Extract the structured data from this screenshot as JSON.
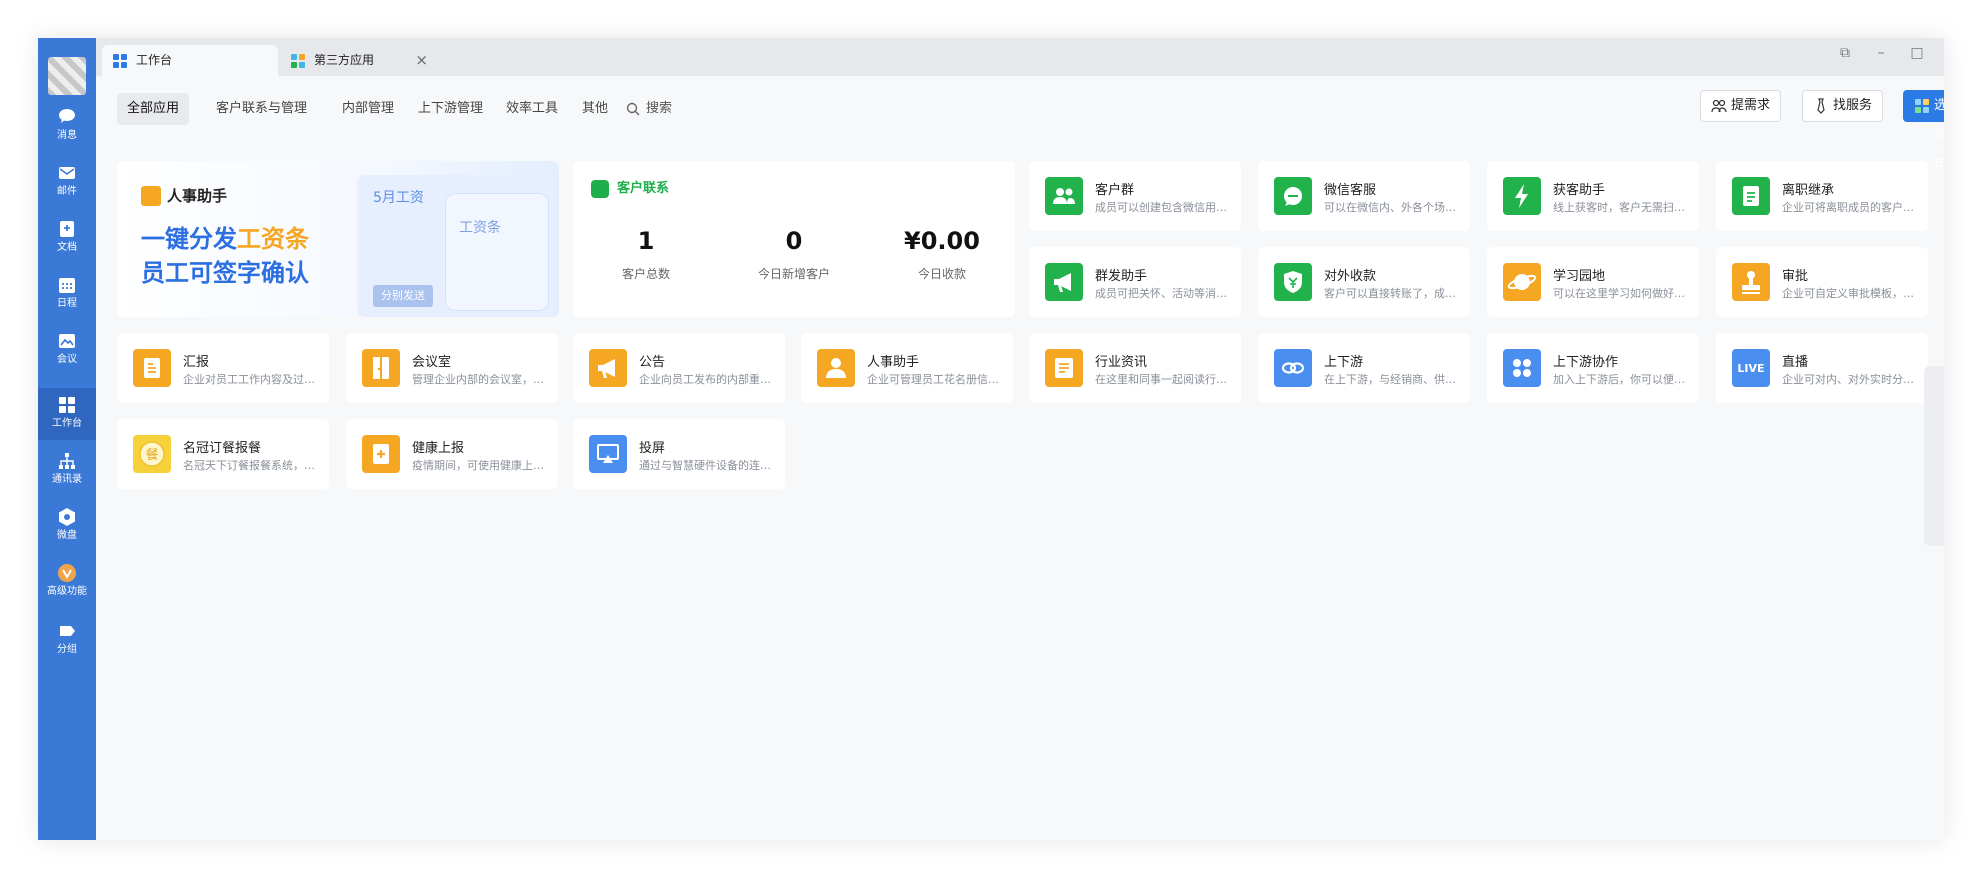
{
  "sidebar": {
    "items": [
      {
        "label": "消息",
        "icon": "chat-bubble-icon"
      },
      {
        "label": "邮件",
        "icon": "mail-icon"
      },
      {
        "label": "文档",
        "icon": "document-icon"
      },
      {
        "label": "日程",
        "icon": "calendar-icon"
      },
      {
        "label": "会议",
        "icon": "meeting-icon"
      },
      {
        "label": "工作台",
        "icon": "workbench-icon"
      },
      {
        "label": "通讯录",
        "icon": "contacts-icon"
      },
      {
        "label": "微盘",
        "icon": "drive-icon"
      },
      {
        "label": "高级功能",
        "icon": "advanced-icon"
      },
      {
        "label": "分组",
        "icon": "group-icon"
      }
    ]
  },
  "tabs": [
    {
      "label": "工作台"
    },
    {
      "label": "第三方应用"
    }
  ],
  "filters": [
    "全部应用",
    "客户联系与管理",
    "内部管理",
    "上下游管理",
    "效率工具",
    "其他"
  ],
  "search": {
    "label": "搜索"
  },
  "actions": {
    "request": "提需求",
    "service": "找服务",
    "select_apps": "选应用"
  },
  "banner": {
    "title": "人事助手",
    "line1_pre": "一键分发",
    "line1_accent": "工资条",
    "line2": "员工可签字确认",
    "card_title": "5月工资",
    "card2_title": "工资条",
    "card_button": "分别发送"
  },
  "crm": {
    "title": "客户联系",
    "stats": [
      {
        "value": "1",
        "label": "客户总数"
      },
      {
        "value": "0",
        "label": "今日新增客户"
      },
      {
        "value": "¥0.00",
        "label": "今日收款"
      }
    ]
  },
  "apps": [
    {
      "title": "客户群",
      "desc": "成员可以创建包含微信用户的客户群",
      "color": "#22b24c",
      "icon": "customer-group-icon"
    },
    {
      "title": "微信客服",
      "desc": "可以在微信内、外各个场景中接入",
      "color": "#22b24c",
      "icon": "wechat-service-icon"
    },
    {
      "title": "获客助手",
      "desc": "线上获客时，客户无需扫码即可添加",
      "color": "#22b24c",
      "icon": "lightning-icon"
    },
    {
      "title": "离职继承",
      "desc": "企业可将离职成员的客户分配给其他成员",
      "color": "#22b24c",
      "icon": "handover-icon"
    },
    {
      "title": "群发助手",
      "desc": "成员可把关怀、活动等消息发送给客户",
      "color": "#22b24c",
      "icon": "megaphone-icon"
    },
    {
      "title": "对外收款",
      "desc": "客户可以直接转账了，成员可以收款",
      "color": "#22b24c",
      "icon": "payment-shield-icon"
    },
    {
      "title": "学习园地",
      "desc": "可以在这里学习如何做好客户联系",
      "color": "#f5a623",
      "icon": "planet-icon"
    },
    {
      "title": "审批",
      "desc": "企业可自定义审批模板，处理日常审批",
      "color": "#f5a623",
      "icon": "stamp-icon"
    },
    {
      "title": "汇报",
      "desc": "企业对员工工作内容及过程进行管理",
      "color": "#f5a623",
      "icon": "report-icon"
    },
    {
      "title": "会议室",
      "desc": "管理企业内部的会议室，便捷预定",
      "color": "#f5a623",
      "icon": "door-icon"
    },
    {
      "title": "公告",
      "desc": "企业向员工发布的内部重要消息通知",
      "color": "#f5a623",
      "icon": "announcement-icon"
    },
    {
      "title": "人事助手",
      "desc": "企业可管理员工花名册信息及资料",
      "color": "#f5a623",
      "icon": "person-icon"
    },
    {
      "title": "行业资讯",
      "desc": "在这里和同事一起阅读行业资讯",
      "color": "#f5a623",
      "icon": "news-icon"
    },
    {
      "title": "上下游",
      "desc": "在上下游，与经销商、供应商一起协作",
      "color": "#4a8ef0",
      "icon": "chain-link-icon"
    },
    {
      "title": "上下游协作",
      "desc": "加入上下游后，你可以便捷协作",
      "color": "#4a8ef0",
      "icon": "grid-apps-icon"
    },
    {
      "title": "直播",
      "desc": "企业可对内、对外实时分享直播内容",
      "color": "#4a8ef0",
      "icon": "live-icon"
    },
    {
      "title": "名冠订餐报餐",
      "desc": "名冠天下订餐报餐系统，便捷管理",
      "color": "#f7d13b",
      "icon": "meal-icon"
    },
    {
      "title": "健康上报",
      "desc": "疫情期间，可使用健康上报收集信息",
      "color": "#f5a623",
      "icon": "health-report-icon"
    },
    {
      "title": "投屏",
      "desc": "通过与智慧硬件设备的连接进行投屏",
      "color": "#4a8ef0",
      "icon": "screen-cast-icon"
    }
  ]
}
